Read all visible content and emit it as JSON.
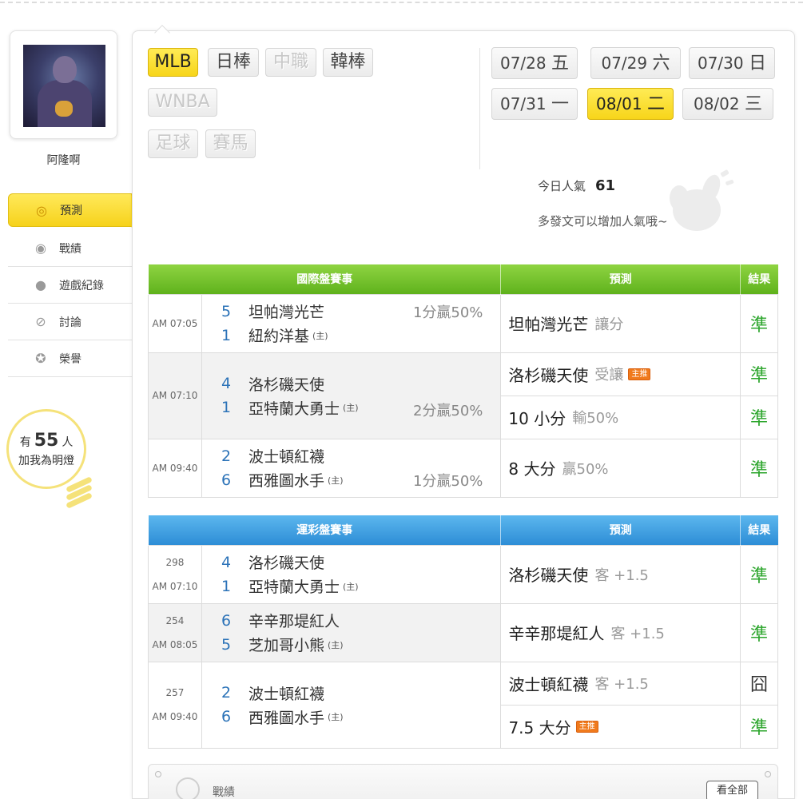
{
  "profile": {
    "username": "阿隆啊"
  },
  "menu": [
    {
      "label": "預測",
      "icon": "target-icon",
      "active": true
    },
    {
      "label": "戰績",
      "icon": "record-icon",
      "active": false
    },
    {
      "label": "遊戲紀錄",
      "icon": "circle-icon",
      "active": false
    },
    {
      "label": "討論",
      "icon": "chat-icon",
      "active": false
    },
    {
      "label": "榮譽",
      "icon": "medal-icon",
      "active": false
    }
  ],
  "fans": {
    "prefix": "有",
    "count": "55",
    "suffix": "人",
    "line2": "加我為明燈"
  },
  "leagues": [
    {
      "label": "MLB",
      "state": "selected"
    },
    {
      "label": "日棒",
      "state": "normal"
    },
    {
      "label": "中職",
      "state": "disabled"
    },
    {
      "label": "韓棒",
      "state": "normal"
    },
    {
      "label": "WNBA",
      "state": "disabled"
    },
    {
      "label": "足球",
      "state": "disabled"
    },
    {
      "label": "賽馬",
      "state": "disabled"
    }
  ],
  "dates": [
    {
      "md": "07/28",
      "wd": "五"
    },
    {
      "md": "07/29",
      "wd": "六"
    },
    {
      "md": "07/30",
      "wd": "日"
    },
    {
      "md": "07/31",
      "wd": "一"
    },
    {
      "md": "08/01",
      "wd": "二",
      "selected": true
    },
    {
      "md": "08/02",
      "wd": "三"
    }
  ],
  "popularity": {
    "label": "今日人氣",
    "value": "61",
    "hint": "多發文可以增加人氣哦~"
  },
  "intl": {
    "headers": [
      "國際盤賽事",
      "預測",
      "結果"
    ],
    "games": [
      {
        "time": "AM 07:05",
        "away": {
          "score": "5",
          "name": "坦帕灣光芒"
        },
        "home": {
          "score": "1",
          "name": "紐約洋基"
        },
        "home_mark": "(主)",
        "handicap": "1分贏50%",
        "preds": [
          {
            "pick": "坦帕灣光芒",
            "detail": "讓分",
            "tag": "",
            "result": "準"
          }
        ]
      },
      {
        "time": "AM 07:10",
        "away": {
          "score": "4",
          "name": "洛杉磯天使"
        },
        "home": {
          "score": "1",
          "name": "亞特蘭大勇士"
        },
        "home_mark": "(主)",
        "handicap": "2分贏50%",
        "preds": [
          {
            "pick": "洛杉磯天使",
            "detail": "受讓",
            "tag": "主推",
            "result": "準"
          },
          {
            "pick": "10 小分",
            "detail": "輸50%",
            "tag": "",
            "result": "準"
          }
        ]
      },
      {
        "time": "AM 09:40",
        "away": {
          "score": "2",
          "name": "波士頓紅襪"
        },
        "home": {
          "score": "6",
          "name": "西雅圖水手"
        },
        "home_mark": "(主)",
        "handicap": "1分贏50%",
        "preds": [
          {
            "pick": "8 大分",
            "detail": "贏50%",
            "tag": "",
            "result": "準"
          }
        ]
      }
    ]
  },
  "lottery": {
    "headers": [
      "運彩盤賽事",
      "預測",
      "結果"
    ],
    "games": [
      {
        "no": "298",
        "time": "AM 07:10",
        "away": {
          "score": "4",
          "name": "洛杉磯天使"
        },
        "home": {
          "score": "1",
          "name": "亞特蘭大勇士"
        },
        "home_mark": "(主)",
        "preds": [
          {
            "pick": "洛杉磯天使",
            "detail": "客 +1.5",
            "tag": "",
            "result": "準"
          }
        ]
      },
      {
        "no": "254",
        "time": "AM 08:05",
        "away": {
          "score": "6",
          "name": "辛辛那堤紅人"
        },
        "home": {
          "score": "5",
          "name": "芝加哥小熊"
        },
        "home_mark": "(主)",
        "preds": [
          {
            "pick": "辛辛那堤紅人",
            "detail": "客 +1.5",
            "tag": "",
            "result": "準"
          }
        ]
      },
      {
        "no": "257",
        "time": "AM 09:40",
        "away": {
          "score": "2",
          "name": "波士頓紅襪"
        },
        "home": {
          "score": "6",
          "name": "西雅圖水手"
        },
        "home_mark": "(主)",
        "preds": [
          {
            "pick": "波士頓紅襪",
            "detail": "客 +1.5",
            "tag": "",
            "result": "囧"
          },
          {
            "pick": "7.5 大分",
            "detail": "",
            "tag": "主推",
            "result": "準"
          }
        ]
      }
    ]
  },
  "record": {
    "label": "戰績",
    "view_all": "看全部"
  },
  "colors": {
    "accent_yellow": "#f7d51a",
    "intl_header": "#5fb21c",
    "lottery_header": "#2d8dd6",
    "correct": "#2ba52b",
    "score_blue": "#2c73b8",
    "tag_orange": "#f07a1c"
  }
}
